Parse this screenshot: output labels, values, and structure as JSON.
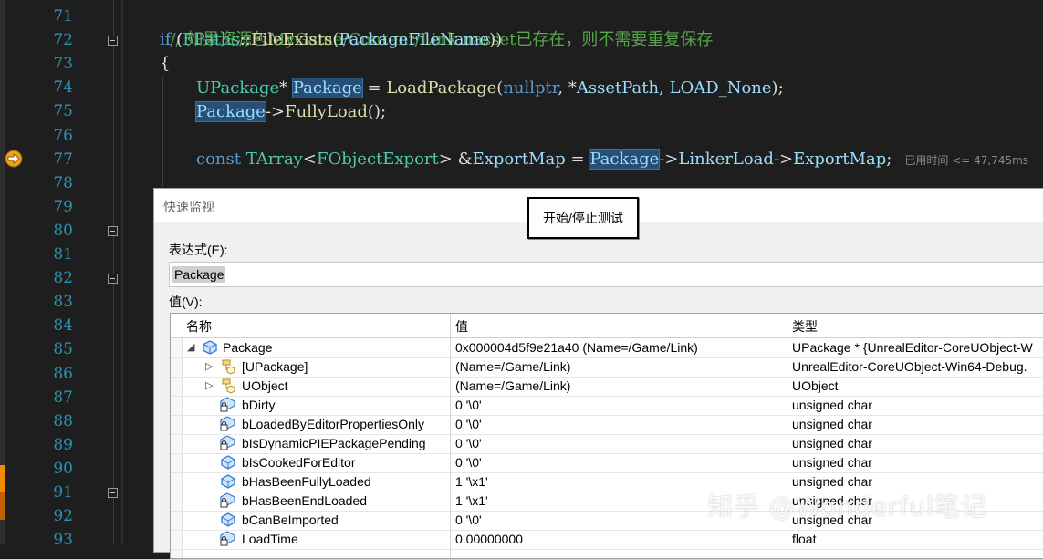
{
  "editor": {
    "line_numbers": [
      "71",
      "72",
      "73",
      "74",
      "75",
      "76",
      "77",
      "78",
      "79",
      "80",
      "81",
      "82",
      "83",
      "84",
      "85",
      "86",
      "87",
      "88",
      "89",
      "90",
      "91",
      "92",
      "93"
    ],
    "line71": "// 如果资源包MyGame/Content/Link.uasset已存在，则不需要重复保存",
    "line72": {
      "kw": "if",
      "p1": " (",
      "ty": "FPaths",
      "p2": "::",
      "fn": "FileExists",
      "p3": "(",
      "vr": "PackageFileName",
      "p4": "))"
    },
    "line73": "{",
    "line74": {
      "ty": "UPackage",
      "p1": "* ",
      "var": "Package",
      "p2": " = ",
      "fn": "LoadPackage",
      "p3": "(",
      "kw": "nullptr",
      "p4": ", *",
      "vr": "AssetPath",
      "p5": ", ",
      "vr2": "LOAD_None",
      "p6": ");"
    },
    "line75": {
      "var": "Package",
      "p1": "->",
      "fn": "FullyLoad",
      "p2": "();"
    },
    "line77": {
      "kw": "const",
      "p0": " ",
      "ty": "TArray",
      "p1": "<",
      "ty2": "FObjectExport",
      "p2": "> &",
      "vr": "ExportMap",
      "p3": " = ",
      "var": "Package",
      "p4": "->",
      "vr2": "LinkerLoad",
      "p5": "->",
      "vr3": "ExportMap",
      "p6": ";"
    },
    "elapsed": "已用时间 <= 47,745ms"
  },
  "dialog": {
    "title": "快速监视",
    "start_stop_button": "开始/停止测试",
    "expression_label": "表达式(E):",
    "expression_value": "Package",
    "value_label": "值(V):",
    "columns": [
      "名称",
      "值",
      "类型"
    ],
    "rows": [
      {
        "name": "Package",
        "value": "0x000004d5f9e21a40 (Name=/Game/Link)",
        "type": "UPackage * {UnrealEditor-CoreUObject-W",
        "expander": "◢",
        "icon": "object-icon"
      },
      {
        "name": "[UPackage]",
        "value": "(Name=/Game/Link)",
        "type": "UnrealEditor-CoreUObject-Win64-Debug.",
        "expander": "▷",
        "icon": "class-base-icon"
      },
      {
        "name": "UObject",
        "value": "(Name=/Game/Link)",
        "type": "UObject",
        "expander": "▷",
        "icon": "class-base-icon"
      },
      {
        "name": "bDirty",
        "value": "0 '\\0'",
        "type": "unsigned char",
        "expander": "",
        "icon": "private-field-icon"
      },
      {
        "name": "bLoadedByEditorPropertiesOnly",
        "value": "0 '\\0'",
        "type": "unsigned char",
        "expander": "",
        "icon": "private-field-icon"
      },
      {
        "name": "bIsDynamicPIEPackagePending",
        "value": "0 '\\0'",
        "type": "unsigned char",
        "expander": "",
        "icon": "private-field-icon"
      },
      {
        "name": "bIsCookedForEditor",
        "value": "0 '\\0'",
        "type": "unsigned char",
        "expander": "",
        "icon": "field-icon"
      },
      {
        "name": "bHasBeenFullyLoaded",
        "value": "1 '\\x1'",
        "type": "unsigned char",
        "expander": "",
        "icon": "field-icon"
      },
      {
        "name": "bHasBeenEndLoaded",
        "value": "1 '\\x1'",
        "type": "unsigned char",
        "expander": "",
        "icon": "private-field-icon"
      },
      {
        "name": "bCanBeImported",
        "value": "0 '\\0'",
        "type": "unsigned char",
        "expander": "",
        "icon": "field-icon"
      },
      {
        "name": "LoadTime",
        "value": "0.00000000",
        "type": "float",
        "expander": "",
        "icon": "private-field-icon"
      }
    ]
  },
  "watermark": "知乎 @Wonderful笔记",
  "colors": {
    "editor_bg": "#1e1e1e",
    "line_number": "#2b91af",
    "comment": "#57a64a",
    "keyword": "#569cd6",
    "type": "#4ec9b0",
    "function": "#dcdcaa",
    "variable": "#9cdcfe",
    "highlight": "#264f78",
    "breakpoint_arrow": "#f0a020"
  }
}
